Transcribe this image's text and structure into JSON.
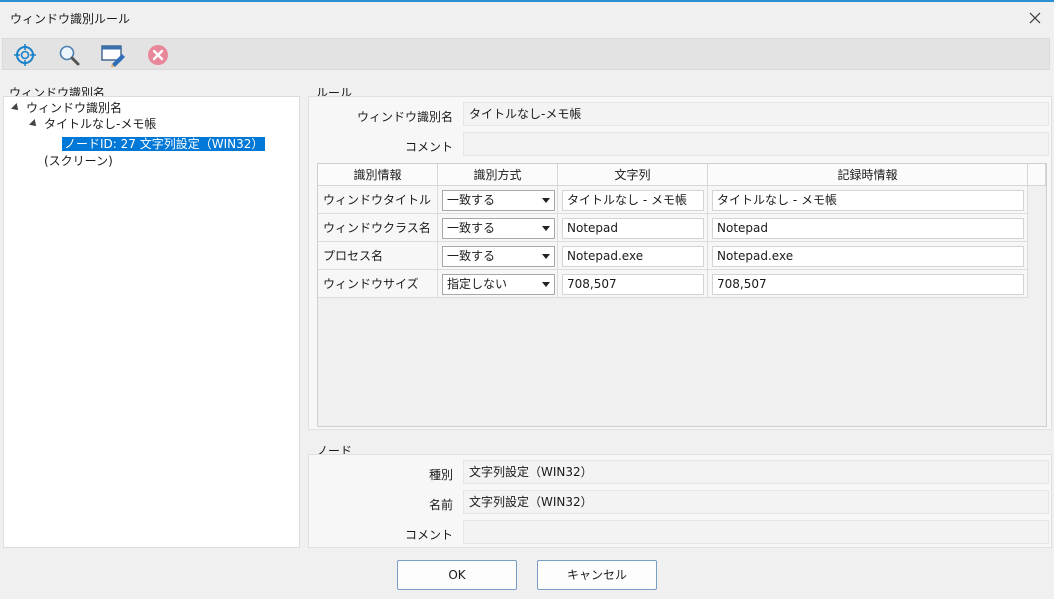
{
  "window": {
    "title": "ウィンドウ識別ルール"
  },
  "toolbar": {
    "icons": [
      "target-icon",
      "search-icon",
      "window-edit-icon",
      "delete-icon"
    ]
  },
  "tree": {
    "caption": "ウィンドウ識別名",
    "root": "ウィンドウ識別名",
    "child": "タイトルなし-メモ帳",
    "node": "ノードID: 27 文字列設定（WIN32）",
    "screen": "(スクリーン)"
  },
  "rule": {
    "caption": "ルール",
    "name_label": "ウィンドウ識別名",
    "name_value": "タイトルなし-メモ帳",
    "comment_label": "コメント",
    "comment_value": "",
    "headers": [
      "識別情報",
      "識別方式",
      "文字列",
      "記録時情報"
    ],
    "rows": [
      {
        "info": "ウィンドウタイトル",
        "method": "一致する",
        "string": "タイトルなし - メモ帳",
        "recorded": "タイトルなし - メモ帳"
      },
      {
        "info": "ウィンドウクラス名",
        "method": "一致する",
        "string": "Notepad",
        "recorded": "Notepad"
      },
      {
        "info": "プロセス名",
        "method": "一致する",
        "string": "Notepad.exe",
        "recorded": "Notepad.exe"
      },
      {
        "info": "ウィンドウサイズ",
        "method": "指定しない",
        "string": "708,507",
        "recorded": "708,507"
      }
    ]
  },
  "node": {
    "caption": "ノード",
    "type_label": "種別",
    "type_value": "文字列設定（WIN32）",
    "name_label": "名前",
    "name_value": "文字列設定（WIN32）",
    "comment_label": "コメント",
    "comment_value": ""
  },
  "buttons": {
    "ok": "OK",
    "cancel": "キャンセル"
  },
  "colors": {
    "accent": "#0078d7",
    "top_border": "#2b8fd6",
    "delete": "#e8879a"
  }
}
